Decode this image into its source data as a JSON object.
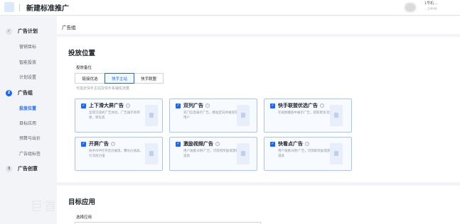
{
  "header": {
    "title": "新建标准推广",
    "user_line1": "1号机...",
    "user_line2": "...0444"
  },
  "sidebar": {
    "steps": [
      {
        "num": "✓",
        "label": "广告计划",
        "state": "done",
        "items": [
          {
            "label": "营销目标"
          },
          {
            "label": "智能投放"
          },
          {
            "label": "计划设置"
          }
        ]
      },
      {
        "num": "2",
        "label": "广告组",
        "state": "active",
        "items": [
          {
            "label": "投放位置",
            "active": true
          },
          {
            "label": "目标应用"
          },
          {
            "label": "预算与出价"
          },
          {
            "label": "广告组标签"
          }
        ]
      },
      {
        "num": "3",
        "label": "广告创意",
        "state": "todo",
        "items": []
      }
    ],
    "watermark": "巨首"
  },
  "breadcrumb": "广告组",
  "placement": {
    "section_title": "投放位置",
    "field_label": "投放备位",
    "segments": [
      {
        "label": "链接优选",
        "active": false
      },
      {
        "label": "快手主站",
        "active": true
      },
      {
        "label": "快手联盟",
        "active": false
      }
    ],
    "hint": "可指定快手主站及快手系辅佐流量",
    "options": [
      {
        "title": "上下滑大屏广告",
        "desc": "呈现沉浸式广告体验，广告展示效率更，转化高",
        "checked": true
      },
      {
        "title": "双列广告",
        "desc": "双门信息展示广告，精准定向并展现在用户",
        "checked": true
      },
      {
        "title": "快手联盟优选广告",
        "desc": "在视频播放中展示广告，获取更多流量",
        "checked": true
      },
      {
        "title": "开屏广告",
        "desc": "快手APP打开首页展现，曝光价值高，引流效力强",
        "checked": true
      },
      {
        "title": "激励视频广告",
        "desc": "用户观看30秒广告，可获得奖励或游戏道具",
        "checked": true
      },
      {
        "title": "快看点广告",
        "desc": "用户观看30秒广告，可领取奖励或游戏道具",
        "checked": true
      }
    ]
  },
  "target_app": {
    "section_title": "目标应用",
    "field_label": "选择应用"
  },
  "colors": {
    "accent": "#1966ff",
    "card_border": "#a9c4f7",
    "card_bg": "#f7faff"
  }
}
